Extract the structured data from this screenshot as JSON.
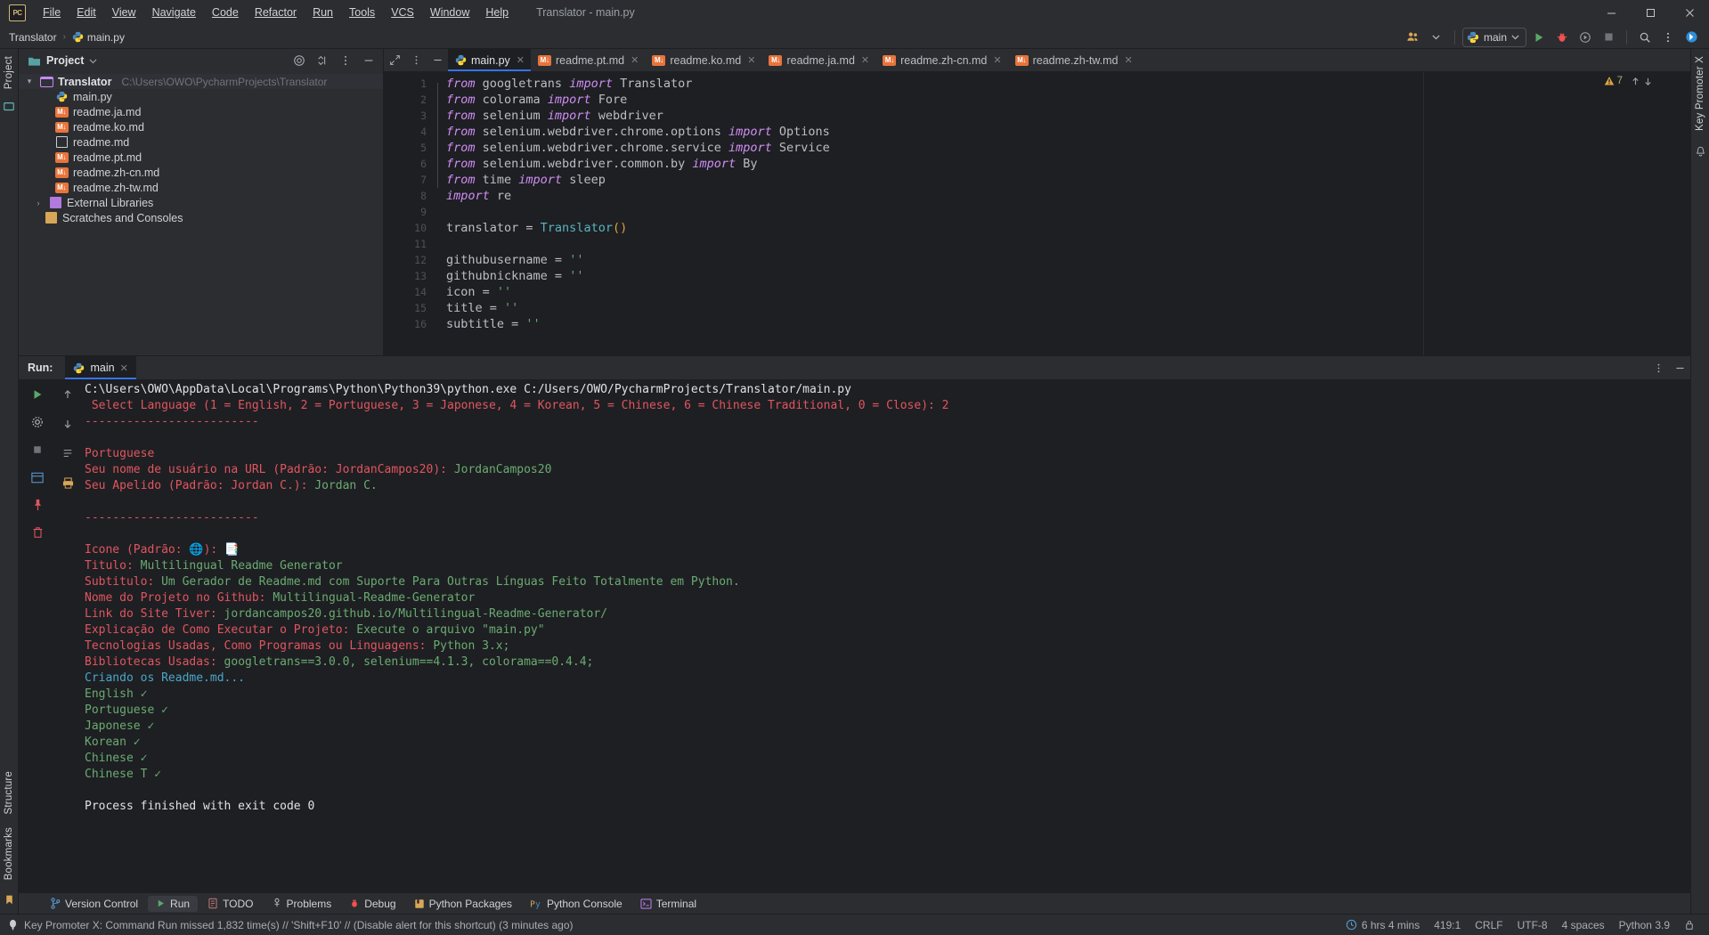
{
  "window": {
    "title": "Translator - main.py",
    "logo_text": "PC",
    "minimize": "—",
    "maximize": "▢",
    "close": "✕"
  },
  "menubar": {
    "items": [
      {
        "label": "File",
        "icon": "file-menu"
      },
      {
        "label": "Edit",
        "icon": "edit-menu"
      },
      {
        "label": "View",
        "icon": "view-menu"
      },
      {
        "label": "Navigate",
        "icon": "navigate-menu"
      },
      {
        "label": "Code",
        "icon": "code-menu"
      },
      {
        "label": "Refactor",
        "icon": "refactor-menu"
      },
      {
        "label": "Run",
        "icon": "run-menu"
      },
      {
        "label": "Tools",
        "icon": "tools-menu"
      },
      {
        "label": "VCS",
        "icon": "vcs-menu"
      },
      {
        "label": "Window",
        "icon": "window-menu"
      },
      {
        "label": "Help",
        "icon": "help-menu"
      }
    ]
  },
  "navbar": {
    "breadcrumb": [
      {
        "label": "Translator",
        "icon": "project-node"
      },
      {
        "label": "main.py",
        "icon": "python-file-icon"
      }
    ],
    "separator": "›",
    "run_config": "main",
    "toolbar_icons": [
      "users-icon",
      "chevron-down-icon",
      "run-icon",
      "debug-icon",
      "coverage-icon",
      "stop-icon",
      "search-everywhere-icon",
      "more-options-icon",
      "ai-assistant-icon"
    ]
  },
  "left_strip": {
    "project_label": "Project",
    "structure_label": "Structure",
    "bookmarks_label": "Bookmarks"
  },
  "right_strip": {
    "notifications_label": "Notifications",
    "promoter_label": "Key Promoter X"
  },
  "project_tool_window": {
    "title": "Project",
    "header_icons": [
      "settings-target-icon",
      "collapse-all-icon",
      "hide-icon",
      "more-icon"
    ],
    "tree": [
      {
        "label": "Translator",
        "path": "C:\\Users\\OWO\\PycharmProjects\\Translator",
        "icon": "folder-icon",
        "depth": 0,
        "arrow": "▾",
        "bold": true,
        "selected": true
      },
      {
        "label": "main.py",
        "path": "",
        "icon": "python-file-icon",
        "depth": 1,
        "arrow": "",
        "bold": false,
        "selected": false
      },
      {
        "label": "readme.ja.md",
        "path": "",
        "icon": "markdown-icon",
        "depth": 1,
        "arrow": "",
        "bold": false,
        "selected": false
      },
      {
        "label": "readme.ko.md",
        "path": "",
        "icon": "markdown-icon",
        "depth": 1,
        "arrow": "",
        "bold": false,
        "selected": false
      },
      {
        "label": "readme.md",
        "path": "",
        "icon": "readme-icon",
        "depth": 1,
        "arrow": "",
        "bold": false,
        "selected": false
      },
      {
        "label": "readme.pt.md",
        "path": "",
        "icon": "markdown-icon",
        "depth": 1,
        "arrow": "",
        "bold": false,
        "selected": false
      },
      {
        "label": "readme.zh-cn.md",
        "path": "",
        "icon": "markdown-icon",
        "depth": 1,
        "arrow": "",
        "bold": false,
        "selected": false
      },
      {
        "label": "readme.zh-tw.md",
        "path": "",
        "icon": "markdown-icon",
        "depth": 1,
        "arrow": "",
        "bold": false,
        "selected": false
      },
      {
        "label": "External Libraries",
        "path": "",
        "icon": "library-icon",
        "depth": 0,
        "arrow": "›",
        "bold": false,
        "selected": false
      },
      {
        "label": "Scratches and Consoles",
        "path": "",
        "icon": "scratch-icon",
        "depth": 0,
        "arrow": "",
        "bold": false,
        "selected": false
      }
    ]
  },
  "editor": {
    "tabs": [
      {
        "label": "main.py",
        "icon": "python-file-icon",
        "active": true,
        "close": "✕"
      },
      {
        "label": "readme.pt.md",
        "icon": "markdown-icon",
        "active": false,
        "close": "✕"
      },
      {
        "label": "readme.ko.md",
        "icon": "markdown-icon",
        "active": false,
        "close": "✕"
      },
      {
        "label": "readme.ja.md",
        "icon": "markdown-icon",
        "active": false,
        "close": "✕"
      },
      {
        "label": "readme.zh-cn.md",
        "icon": "markdown-icon",
        "active": false,
        "close": "✕"
      },
      {
        "label": "readme.zh-tw.md",
        "icon": "markdown-icon",
        "active": false,
        "close": "✕"
      }
    ],
    "warning_count": "7",
    "line_numbers": [
      "1",
      "2",
      "3",
      "4",
      "5",
      "6",
      "7",
      "8",
      "9",
      "10",
      "11",
      "12",
      "13",
      "14",
      "15",
      "16"
    ],
    "code_lines": [
      [
        {
          "t": "from ",
          "c": "kw"
        },
        {
          "t": "googletrans ",
          "c": "id"
        },
        {
          "t": "import ",
          "c": "kw"
        },
        {
          "t": "Translator",
          "c": "id"
        }
      ],
      [
        {
          "t": "from ",
          "c": "kw"
        },
        {
          "t": "colorama ",
          "c": "id"
        },
        {
          "t": "import ",
          "c": "kw"
        },
        {
          "t": "Fore",
          "c": "id"
        }
      ],
      [
        {
          "t": "from ",
          "c": "kw"
        },
        {
          "t": "selenium ",
          "c": "id"
        },
        {
          "t": "import ",
          "c": "kw"
        },
        {
          "t": "webdriver",
          "c": "id"
        }
      ],
      [
        {
          "t": "from ",
          "c": "kw"
        },
        {
          "t": "selenium.webdriver.chrome.options ",
          "c": "id"
        },
        {
          "t": "import ",
          "c": "kw"
        },
        {
          "t": "Options",
          "c": "id"
        }
      ],
      [
        {
          "t": "from ",
          "c": "kw"
        },
        {
          "t": "selenium.webdriver.chrome.service ",
          "c": "id"
        },
        {
          "t": "import ",
          "c": "kw"
        },
        {
          "t": "Service",
          "c": "id"
        }
      ],
      [
        {
          "t": "from ",
          "c": "kw"
        },
        {
          "t": "selenium.webdriver.common.by ",
          "c": "id"
        },
        {
          "t": "import ",
          "c": "kw"
        },
        {
          "t": "By",
          "c": "id"
        }
      ],
      [
        {
          "t": "from ",
          "c": "kw"
        },
        {
          "t": "time ",
          "c": "id"
        },
        {
          "t": "import ",
          "c": "kw"
        },
        {
          "t": "sleep",
          "c": "id"
        }
      ],
      [
        {
          "t": "import ",
          "c": "kw"
        },
        {
          "t": "re",
          "c": "id"
        }
      ],
      [],
      [
        {
          "t": "translator ",
          "c": "id"
        },
        {
          "t": "= ",
          "c": "op"
        },
        {
          "t": "Translator",
          "c": "cls"
        },
        {
          "t": "()",
          "c": "paren"
        }
      ],
      [],
      [
        {
          "t": "githubusername ",
          "c": "id"
        },
        {
          "t": "= ",
          "c": "op"
        },
        {
          "t": "''",
          "c": "str"
        }
      ],
      [
        {
          "t": "githubnickname ",
          "c": "id"
        },
        {
          "t": "= ",
          "c": "op"
        },
        {
          "t": "''",
          "c": "str"
        }
      ],
      [
        {
          "t": "icon ",
          "c": "id"
        },
        {
          "t": "= ",
          "c": "op"
        },
        {
          "t": "''",
          "c": "str"
        }
      ],
      [
        {
          "t": "title ",
          "c": "id"
        },
        {
          "t": "= ",
          "c": "op"
        },
        {
          "t": "''",
          "c": "str"
        }
      ],
      [
        {
          "t": "subtitle ",
          "c": "id"
        },
        {
          "t": "= ",
          "c": "op"
        },
        {
          "t": "''",
          "c": "str"
        }
      ]
    ]
  },
  "run_tool_window": {
    "label": "Run:",
    "tab": {
      "label": "main",
      "icon": "python-file-icon",
      "close": "✕"
    },
    "side_icons": [
      "rerun-icon",
      "settings-icon",
      "stop-icon",
      "pin-icon",
      "layout-icon",
      "print-icon",
      "trash-icon",
      "scroll-up-icon",
      "scroll-down-icon"
    ],
    "header_icons": [
      "more-icon",
      "hide-icon"
    ],
    "console_lines": [
      {
        "text": "C:\\Users\\OWO\\AppData\\Local\\Programs\\Python\\Python39\\python.exe C:/Users/OWO/PycharmProjects/Translator/main.py",
        "color": "white"
      },
      {
        "text": " Select Language (1 = English, 2 = Portuguese, 3 = Japonese, 4 = Korean, 5 = Chinese, 6 = Chinese Traditional, 0 = Close): 2",
        "color": "red"
      },
      {
        "text": "-------------------------",
        "color": "red"
      },
      {
        "text": "",
        "color": "red"
      },
      {
        "text": "Portuguese",
        "color": "red"
      },
      {
        "text": "Seu nome de usuário na URL (Padrão: JordanCampos20): JordanCampos20",
        "color": "red-green-mix"
      },
      {
        "text": "Seu Apelido (Padrão: Jordan C.): Jordan C.",
        "color": "red-green-mix"
      },
      {
        "text": "",
        "color": "red"
      },
      {
        "text": "-------------------------",
        "color": "red"
      },
      {
        "text": "",
        "color": "red"
      },
      {
        "text": "Icone (Padrão: 🌐): 📑",
        "color": "red-green-mix"
      },
      {
        "text": "Titulo: Multilingual Readme Generator",
        "color": "red-green-mix"
      },
      {
        "text": "Subtitulo: Um Gerador de Readme.md com Suporte Para Outras Línguas Feito Totalmente em Python.",
        "color": "red-green-mix"
      },
      {
        "text": "Nome do Projeto no Github: Multilingual-Readme-Generator",
        "color": "red-green-mix"
      },
      {
        "text": "Link do Site Tiver: jordancampos20.github.io/Multilingual-Readme-Generator/",
        "color": "red-green-mix"
      },
      {
        "text": "Explicação de Como Executar o Projeto: Execute o arquivo \"main.py\"",
        "color": "red-green-mix"
      },
      {
        "text": "Tecnologias Usadas, Como Programas ou Linguagens: Python 3.x;",
        "color": "red-green-mix"
      },
      {
        "text": "Bibliotecas Usadas: googletrans==3.0.0, selenium==4.1.3, colorama==0.4.4;",
        "color": "red-green-mix"
      },
      {
        "text": "Criando os Readme.md...",
        "color": "cyan"
      },
      {
        "text": "English ✓",
        "color": "green"
      },
      {
        "text": "Portuguese ✓",
        "color": "green"
      },
      {
        "text": "Japonese ✓",
        "color": "green"
      },
      {
        "text": "Korean ✓",
        "color": "green"
      },
      {
        "text": "Chinese ✓",
        "color": "green"
      },
      {
        "text": "Chinese T ✓",
        "color": "green"
      },
      {
        "text": "",
        "color": "white"
      },
      {
        "text": "Process finished with exit code 0",
        "color": "white"
      }
    ],
    "console_segments": [
      {
        "segs": [
          {
            "t": "C:\\Users\\OWO\\AppData\\Local\\Programs\\Python\\Python39\\python.exe C:/Users/OWO/PycharmProjects/Translator/main.py",
            "c": "c-bold"
          }
        ]
      },
      {
        "segs": [
          {
            "t": " Select Language (1 = English, 2 = Portuguese, 3 = Japonese, 4 = Korean, 5 = Chinese, 6 = Chinese Traditional, 0 = Close): 2",
            "c": "c-red"
          }
        ]
      },
      {
        "segs": [
          {
            "t": "-------------------------",
            "c": "c-red"
          }
        ]
      },
      {
        "segs": []
      },
      {
        "segs": [
          {
            "t": "Portuguese",
            "c": "c-red"
          }
        ]
      },
      {
        "segs": [
          {
            "t": "Seu nome de usuário na URL (Padrão: JordanCampos20): ",
            "c": "c-red"
          },
          {
            "t": "JordanCampos20",
            "c": "c-green"
          }
        ]
      },
      {
        "segs": [
          {
            "t": "Seu Apelido (Padrão: Jordan C.): ",
            "c": "c-red"
          },
          {
            "t": "Jordan C.",
            "c": "c-green"
          }
        ]
      },
      {
        "segs": []
      },
      {
        "segs": [
          {
            "t": "-------------------------",
            "c": "c-red"
          }
        ]
      },
      {
        "segs": []
      },
      {
        "segs": [
          {
            "t": "Icone (Padrão: 🌐): ",
            "c": "c-red"
          },
          {
            "t": "📑",
            "c": "c-green"
          }
        ]
      },
      {
        "segs": [
          {
            "t": "Titulo: ",
            "c": "c-red"
          },
          {
            "t": "Multilingual Readme Generator",
            "c": "c-green"
          }
        ]
      },
      {
        "segs": [
          {
            "t": "Subtitulo: ",
            "c": "c-red"
          },
          {
            "t": "Um Gerador de Readme.md com Suporte Para Outras Línguas Feito Totalmente em Python.",
            "c": "c-green"
          }
        ]
      },
      {
        "segs": [
          {
            "t": "Nome do Projeto no Github: ",
            "c": "c-red"
          },
          {
            "t": "Multilingual-Readme-Generator",
            "c": "c-green"
          }
        ]
      },
      {
        "segs": [
          {
            "t": "Link do Site Tiver: ",
            "c": "c-red"
          },
          {
            "t": "jordancampos20.github.io/Multilingual-Readme-Generator/",
            "c": "c-green"
          }
        ]
      },
      {
        "segs": [
          {
            "t": "Explicação de Como Executar o Projeto: ",
            "c": "c-red"
          },
          {
            "t": "Execute o arquivo \"main.py\"",
            "c": "c-green"
          }
        ]
      },
      {
        "segs": [
          {
            "t": "Tecnologias Usadas, Como Programas ou Linguagens: ",
            "c": "c-red"
          },
          {
            "t": "Python 3.x;",
            "c": "c-green"
          }
        ]
      },
      {
        "segs": [
          {
            "t": "Bibliotecas Usadas: ",
            "c": "c-red"
          },
          {
            "t": "googletrans==3.0.0, selenium==4.1.3, colorama==0.4.4;",
            "c": "c-green"
          }
        ]
      },
      {
        "segs": [
          {
            "t": "Criando os Readme.md...",
            "c": "c-cyan"
          }
        ]
      },
      {
        "segs": [
          {
            "t": "English ✓",
            "c": "c-green"
          }
        ]
      },
      {
        "segs": [
          {
            "t": "Portuguese ✓",
            "c": "c-green"
          }
        ]
      },
      {
        "segs": [
          {
            "t": "Japonese ✓",
            "c": "c-green"
          }
        ]
      },
      {
        "segs": [
          {
            "t": "Korean ✓",
            "c": "c-green"
          }
        ]
      },
      {
        "segs": [
          {
            "t": "Chinese ✓",
            "c": "c-green"
          }
        ]
      },
      {
        "segs": [
          {
            "t": "Chinese T ✓",
            "c": "c-green"
          }
        ]
      },
      {
        "segs": []
      },
      {
        "segs": [
          {
            "t": "Process finished with exit code 0",
            "c": "c-bold"
          }
        ]
      }
    ]
  },
  "bottom_bar": {
    "items": [
      {
        "label": "Version Control",
        "icon": "vcs-branch-icon",
        "active": false
      },
      {
        "label": "Run",
        "icon": "run-icon",
        "active": true
      },
      {
        "label": "TODO",
        "icon": "todo-icon",
        "active": false
      },
      {
        "label": "Problems",
        "icon": "problems-icon",
        "active": false
      },
      {
        "label": "Debug",
        "icon": "debug-icon",
        "active": false
      },
      {
        "label": "Python Packages",
        "icon": "python-packages-icon",
        "active": false
      },
      {
        "label": "Python Console",
        "icon": "python-console-icon",
        "active": false
      },
      {
        "label": "Terminal",
        "icon": "terminal-icon",
        "active": false
      }
    ]
  },
  "status_bar": {
    "message": "Key Promoter X: Command Run missed 1,832 time(s) // 'Shift+F10' // (Disable alert for this shortcut) (3 minutes ago)",
    "message_icon": "key-promoter-icon",
    "time_tracker": "6 hrs 4 mins",
    "time_icon": "clock-icon",
    "caret_position": "419:1",
    "line_separator": "CRLF",
    "encoding": "UTF-8",
    "indent": "4 spaces",
    "interpreter": "Python 3.9",
    "lock_icon": "lock-icon"
  },
  "colors": {
    "accent": "#3574f0",
    "bg_main": "#2b2d30",
    "bg_editor": "#1e1f22",
    "text": "#bcbec4",
    "console_red": "#e05561",
    "console_green": "#6aab73",
    "console_cyan": "#4ba6c9",
    "markdown_icon": "#e8743b",
    "warning": "#b3aa6d"
  }
}
